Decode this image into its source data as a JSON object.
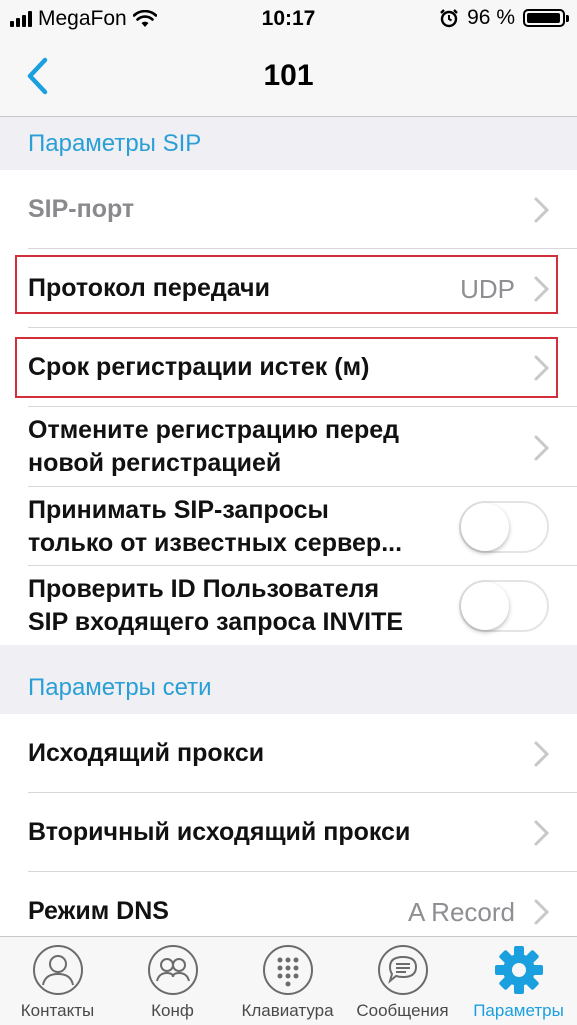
{
  "status_bar": {
    "carrier": "MegaFon",
    "time": "10:17",
    "battery_percent": "96 %",
    "battery_level": 0.96
  },
  "nav": {
    "title": "101",
    "back_icon": "chevron-left-icon"
  },
  "colors": {
    "accent": "#1aa0de",
    "section_header": "#2a9fd6",
    "highlight_border": "#d32f3a"
  },
  "sections": [
    {
      "header": "Параметры SIP",
      "rows": [
        {
          "label": "SIP-порт",
          "value": "",
          "control": "chevron",
          "muted": true
        },
        {
          "label": "Протокол передачи",
          "value": "UDP",
          "control": "chevron",
          "highlighted": true
        },
        {
          "label": "Срок регистрации истек (м)",
          "value": "",
          "control": "chevron",
          "highlighted": true
        },
        {
          "label_line1": "Отмените регистрацию перед",
          "label_line2": "новой регистрацией",
          "control": "chevron"
        },
        {
          "label_line1": "Принимать SIP-запросы",
          "label_line2": "только от известных сервер...",
          "control": "toggle",
          "on": false
        },
        {
          "label_line1": "Проверить ID Пользователя",
          "label_line2": "SIP входящего запроса INVITE",
          "control": "toggle",
          "on": false
        }
      ]
    },
    {
      "header": "Параметры сети",
      "rows": [
        {
          "label": "Исходящий прокси",
          "value": "",
          "control": "chevron"
        },
        {
          "label": "Вторичный исходящий прокси",
          "value": "",
          "control": "chevron"
        },
        {
          "label": "Режим DNS",
          "value": "A Record",
          "control": "chevron"
        }
      ]
    }
  ],
  "tabs": [
    {
      "label": "Контакты",
      "icon": "contact-icon",
      "active": false
    },
    {
      "label": "Конф",
      "icon": "conference-icon",
      "active": false
    },
    {
      "label": "Клавиатура",
      "icon": "keypad-icon",
      "active": false
    },
    {
      "label": "Сообщения",
      "icon": "message-icon",
      "active": false
    },
    {
      "label": "Параметры",
      "icon": "gear-icon",
      "active": true
    }
  ]
}
